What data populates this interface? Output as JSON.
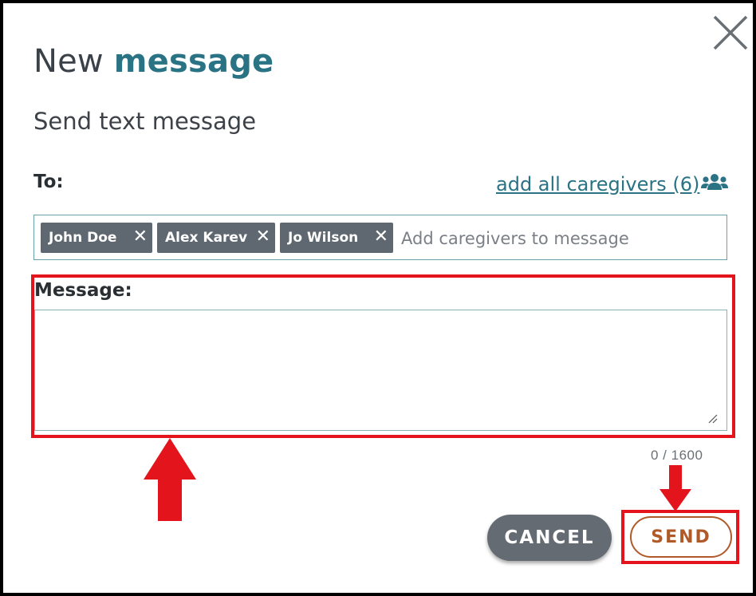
{
  "dialog": {
    "title_light": "New",
    "title_bold": "message",
    "subtitle": "Send text message",
    "close_icon": "close-icon"
  },
  "to": {
    "label": "To:",
    "add_all_label": "add all caregivers (6)",
    "group_icon": "users-icon",
    "recipients": [
      {
        "name": "John Doe"
      },
      {
        "name": "Alex Karev"
      },
      {
        "name": "Jo Wilson"
      }
    ],
    "remove_symbol": "✕",
    "placeholder": "Add caregivers to message"
  },
  "message": {
    "label": "Message:",
    "value": "",
    "counter": "0 / 1600"
  },
  "actions": {
    "cancel_label": "CANCEL",
    "send_label": "SEND"
  },
  "colors": {
    "accent": "#2a7384",
    "chip": "#5f6870",
    "annotation": "#e3141c",
    "send": "#b05a2a"
  }
}
